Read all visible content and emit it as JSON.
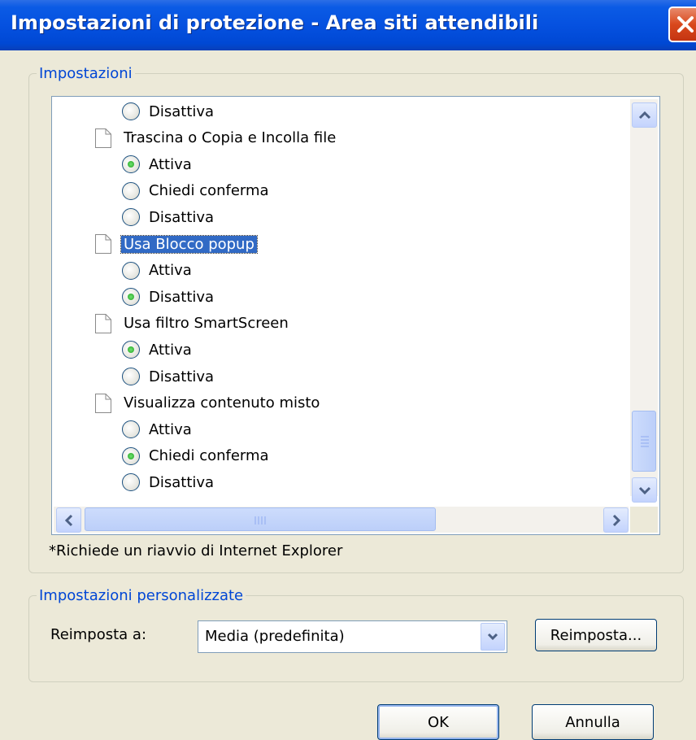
{
  "window": {
    "title": "Impostazioni di protezione - Area siti attendibili"
  },
  "settings_group": {
    "legend": "Impostazioni",
    "items": [
      {
        "type": "radio",
        "label": "Disattiva",
        "checked": false
      },
      {
        "type": "category",
        "label": "Trascina o Copia e Incolla file"
      },
      {
        "type": "radio",
        "label": "Attiva",
        "checked": true
      },
      {
        "type": "radio",
        "label": "Chiedi conferma",
        "checked": false
      },
      {
        "type": "radio",
        "label": "Disattiva",
        "checked": false
      },
      {
        "type": "category",
        "label": "Usa Blocco popup",
        "selected": true
      },
      {
        "type": "radio",
        "label": "Attiva",
        "checked": false
      },
      {
        "type": "radio",
        "label": "Disattiva",
        "checked": true
      },
      {
        "type": "category",
        "label": "Usa filtro SmartScreen"
      },
      {
        "type": "radio",
        "label": "Attiva",
        "checked": true
      },
      {
        "type": "radio",
        "label": "Disattiva",
        "checked": false
      },
      {
        "type": "category",
        "label": "Visualizza contenuto misto"
      },
      {
        "type": "radio",
        "label": "Attiva",
        "checked": false
      },
      {
        "type": "radio",
        "label": "Chiedi conferma",
        "checked": true
      },
      {
        "type": "radio",
        "label": "Disattiva",
        "checked": false
      }
    ],
    "note": "*Richiede un riavvio di Internet Explorer"
  },
  "custom_group": {
    "legend": "Impostazioni personalizzate",
    "reset_label": "Reimposta a:",
    "reset_select_value": "Media (predefinita)",
    "reset_button": "Reimposta..."
  },
  "buttons": {
    "ok": "OK",
    "cancel": "Annulla"
  }
}
